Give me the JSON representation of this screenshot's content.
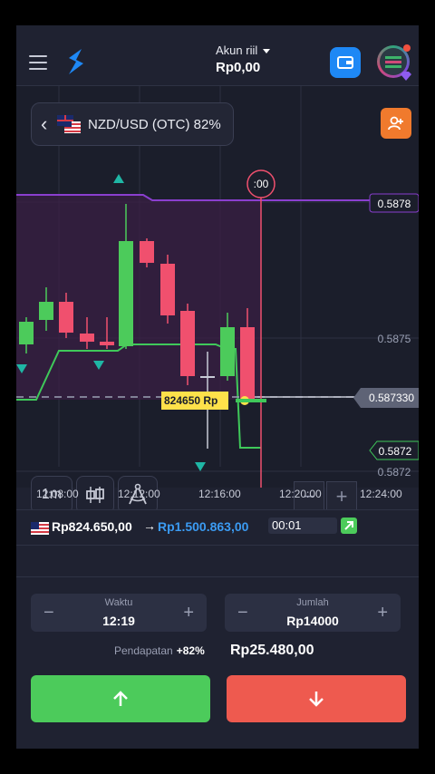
{
  "header": {
    "account_label": "Akun riil",
    "balance": "Rp0,00"
  },
  "chart_header": {
    "pair": "NZD/USD (OTC) 82%"
  },
  "chart": {
    "price_labels": [
      "0.5878",
      "0.5875",
      "0.587330",
      "0.5872",
      "0.5872"
    ],
    "countdown": ":00",
    "entry_tag": "824650 Rp",
    "time_labels": [
      "12:08:00",
      "12:12:00",
      "12:16:00",
      "12:20:00",
      "12:24:00"
    ],
    "timeframe": "1m"
  },
  "trade": {
    "from": "Rp824.650,00",
    "arrow": "→",
    "to": "Rp1.500.863,00",
    "timer": "00:01"
  },
  "controls": {
    "time_label": "Waktu",
    "time_value": "12:19",
    "amount_label": "Jumlah",
    "amount_value": "Rp14000",
    "minus": "−",
    "plus": "+",
    "income_label": "Pendapatan",
    "income_pct": "+82%",
    "income_value": "Rp25.480,00"
  },
  "colors": {
    "up": "#4ccb5b",
    "down": "#f0506e",
    "accent_blue": "#1e88f5",
    "orange": "#f07a2d",
    "sell_button": "#ee5a4f"
  }
}
